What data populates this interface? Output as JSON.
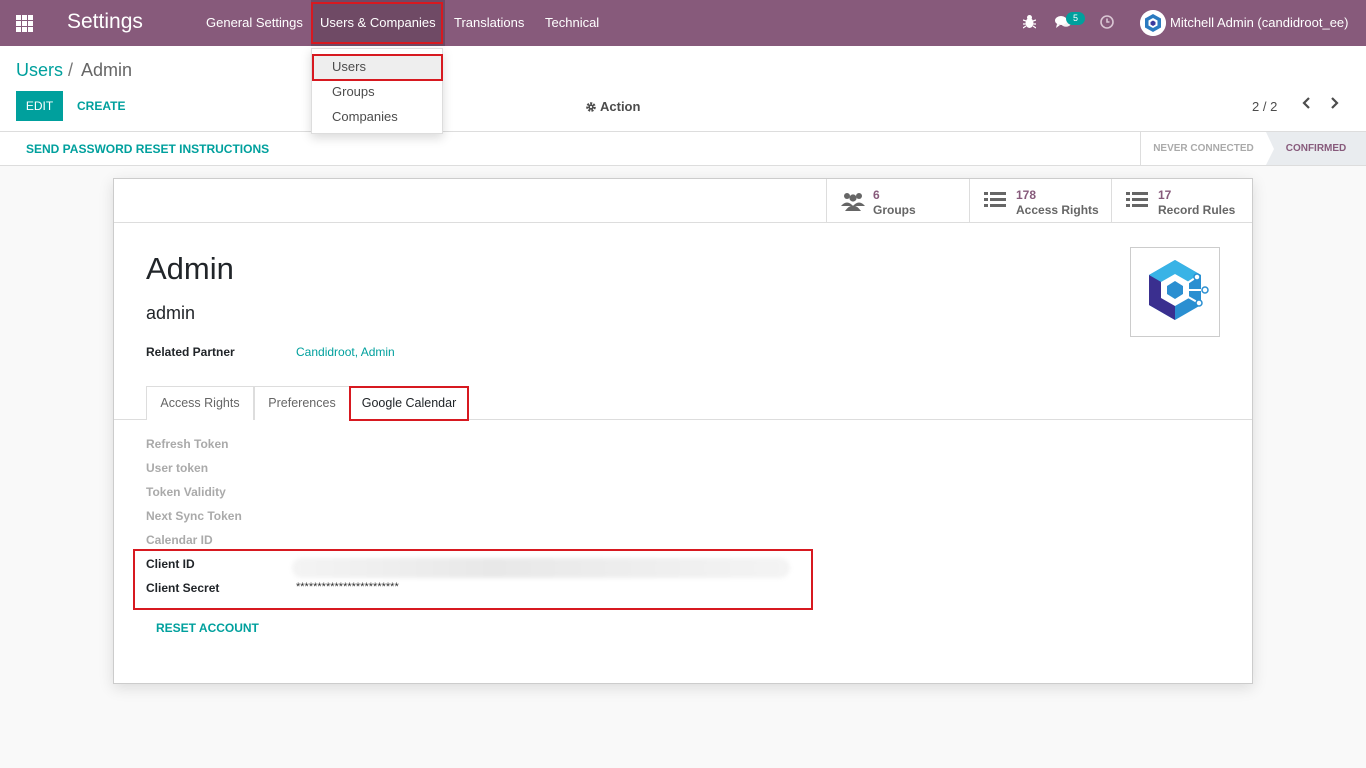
{
  "navbar": {
    "app_title": "Settings",
    "menu": [
      "General Settings",
      "Users & Companies",
      "Translations",
      "Technical"
    ],
    "message_badge": "5",
    "user": "Mitchell Admin (candidroot_ee)"
  },
  "dropdown": {
    "items": [
      "Users",
      "Groups",
      "Companies"
    ]
  },
  "breadcrumb": {
    "parent": "Users",
    "separator": "/",
    "current": "Admin"
  },
  "buttons": {
    "edit": "EDIT",
    "create": "CREATE",
    "action": "Action"
  },
  "pager": {
    "value": "2 / 2",
    "prev": "‹",
    "next": "›"
  },
  "status": {
    "send_password": "SEND PASSWORD RESET INSTRUCTIONS",
    "stages": [
      "NEVER CONNECTED",
      "CONFIRMED"
    ],
    "active_stage": "CONFIRMED"
  },
  "stats": [
    {
      "value": "6",
      "label": "Groups"
    },
    {
      "value": "178",
      "label": "Access Rights"
    },
    {
      "value": "17",
      "label": "Record Rules"
    }
  ],
  "record": {
    "name": "Admin",
    "login": "admin",
    "related_partner_label": "Related Partner",
    "related_partner_value": "Candidroot, Admin"
  },
  "tabs": [
    "Access Rights",
    "Preferences",
    "Google Calendar"
  ],
  "active_tab": "Google Calendar",
  "fields": {
    "refresh_token": "Refresh Token",
    "user_token": "User token",
    "token_validity": "Token Validity",
    "next_sync_token": "Next Sync Token",
    "calendar_id": "Calendar ID",
    "client_id": "Client ID",
    "client_secret": "Client Secret",
    "client_secret_value": "************************"
  },
  "reset_account": "RESET ACCOUNT",
  "colors": {
    "brand": "#875a7b",
    "accent": "#00a09d",
    "highlight": "#d71920"
  }
}
